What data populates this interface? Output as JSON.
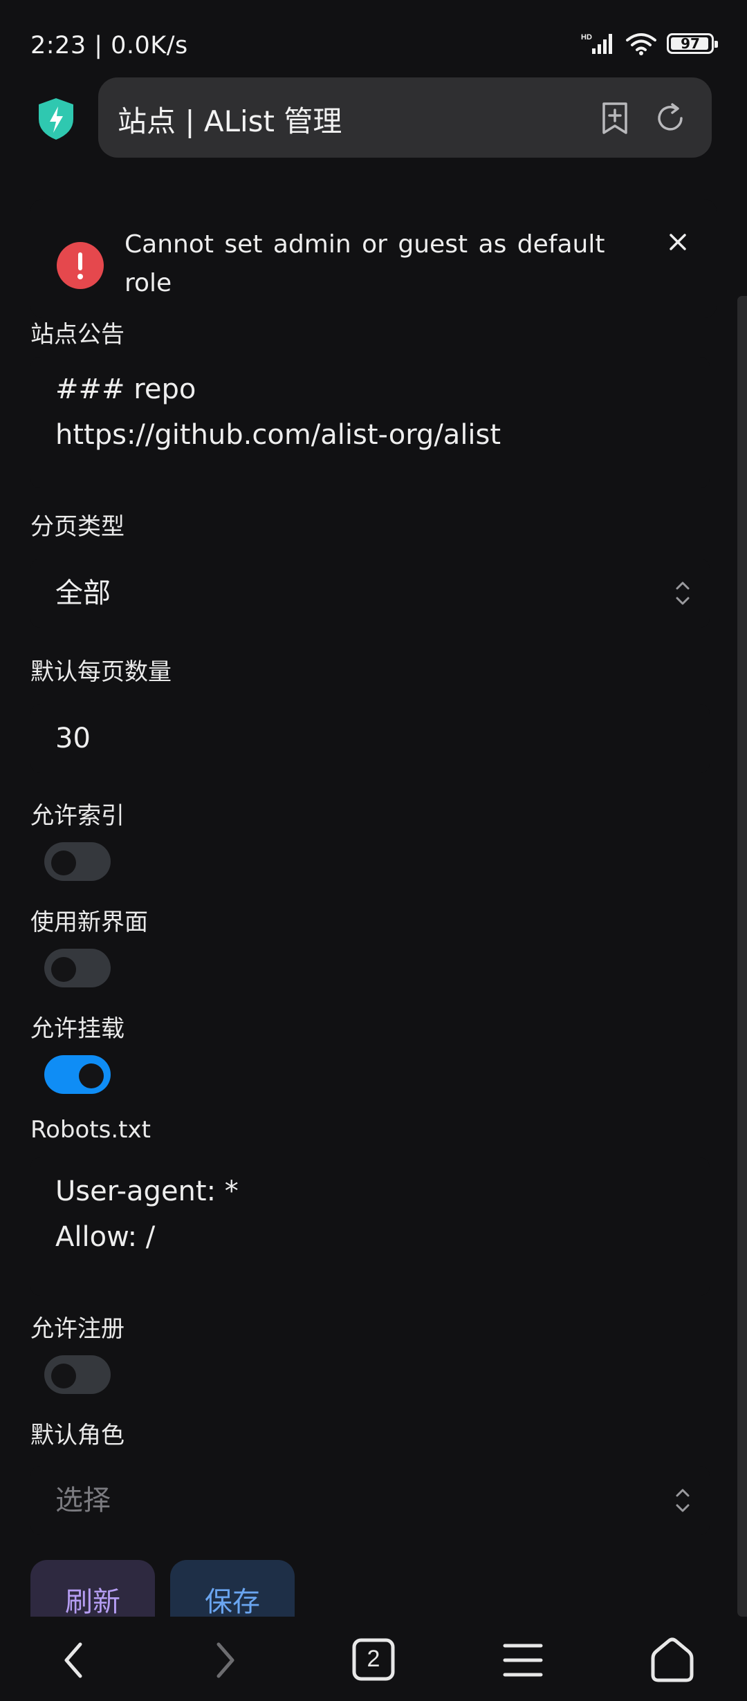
{
  "status_bar": {
    "time": "2:23 | 0.0K/s",
    "network_label": "HD",
    "battery_level": 97,
    "battery_text": "97"
  },
  "browser": {
    "title": "站点 | AList 管理",
    "icons": [
      "shield-icon",
      "bookmark-add-icon",
      "refresh-icon"
    ]
  },
  "toast": {
    "message": "Cannot set admin or guest as default role",
    "icon": "error-icon",
    "color": "#e5484d"
  },
  "form": {
    "announcement": {
      "label": "站点公告",
      "lines": [
        "### repo",
        "https://github.com/alist-org/alist"
      ]
    },
    "pagination_type": {
      "label": "分页类型",
      "value": "全部"
    },
    "default_page_size": {
      "label": "默认每页数量",
      "value": "30"
    },
    "allow_indexed": {
      "label": "允许索引",
      "on": false
    },
    "use_new_ui": {
      "label": "使用新界面",
      "on": false
    },
    "allow_mounted": {
      "label": "允许挂载",
      "on": true
    },
    "robots_txt": {
      "label": "Robots.txt",
      "lines": [
        "User-agent: *",
        "Allow: /"
      ]
    },
    "allow_register": {
      "label": "允许注册",
      "on": false
    },
    "default_role": {
      "label": "默认角色",
      "placeholder": "选择"
    }
  },
  "buttons": {
    "refresh": "刷新",
    "save": "保存"
  },
  "nav": {
    "tab_count": "2"
  },
  "colors": {
    "toggle_on": "#0f8df5",
    "toggle_off": "#35383d",
    "refresh_text": "#b59df2",
    "save_text": "#6aa5f0"
  }
}
